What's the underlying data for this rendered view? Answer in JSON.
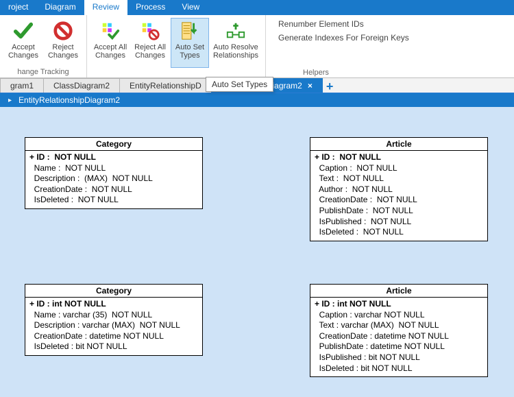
{
  "menu": {
    "tabs": [
      "roject",
      "Diagram",
      "Review",
      "Process",
      "View"
    ],
    "active_index": 2
  },
  "ribbon": {
    "buttons": [
      {
        "label": "Accept\nChanges",
        "icon": "accept"
      },
      {
        "label": "Reject\nChanges",
        "icon": "reject"
      },
      {
        "label": "Accept All\nChanges",
        "icon": "accept-all"
      },
      {
        "label": "Reject All\nChanges",
        "icon": "reject-all"
      },
      {
        "label": "Auto Set\nTypes",
        "icon": "auto-set-types",
        "active": true
      },
      {
        "label": "Auto Resolve\nRelationships",
        "icon": "auto-resolve"
      }
    ],
    "group_label_left": "hange Tracking",
    "helper_links": [
      "Renumber Element IDs",
      "Generate Indexes For Foreign Keys"
    ],
    "helper_group_label": "Helpers"
  },
  "tooltip": "Auto Set Types",
  "doc_tabs": {
    "tabs": [
      "gram1",
      "ClassDiagram2",
      "EntityRelationshipD",
      "RelationshipDiagram2"
    ],
    "active_index": 3
  },
  "breadcrumb": {
    "marker": "▸",
    "text": "EntityRelationshipDiagram2"
  },
  "entities": {
    "cat1": {
      "title": "Category",
      "rows": [
        "+ ID :  NOT NULL",
        "  Name :  NOT NULL",
        "  Description :  (MAX)  NOT NULL",
        "  CreationDate :  NOT NULL",
        "  IsDeleted :  NOT NULL"
      ]
    },
    "art1": {
      "title": "Article",
      "rows": [
        "+ ID :  NOT NULL",
        "  Caption :  NOT NULL",
        "  Text :  NOT NULL",
        "  Author :  NOT NULL",
        "  CreationDate :  NOT NULL",
        "  PublishDate :  NOT NULL",
        "  IsPublished :  NOT NULL",
        "  IsDeleted :  NOT NULL"
      ]
    },
    "cat2": {
      "title": "Category",
      "rows": [
        "+ ID : int NOT NULL",
        "  Name : varchar (35)  NOT NULL",
        "  Description : varchar (MAX)  NOT NULL",
        "  CreationDate : datetime NOT NULL",
        "  IsDeleted : bit NOT NULL"
      ]
    },
    "art2": {
      "title": "Article",
      "rows": [
        "+ ID : int NOT NULL",
        "  Caption : varchar NOT NULL",
        "  Text : varchar (MAX)  NOT NULL",
        "  CreationDate : datetime NOT NULL",
        "  PublishDate : datetime NOT NULL",
        "  IsPublished : bit NOT NULL",
        "  IsDeleted : bit NOT NULL"
      ]
    }
  }
}
